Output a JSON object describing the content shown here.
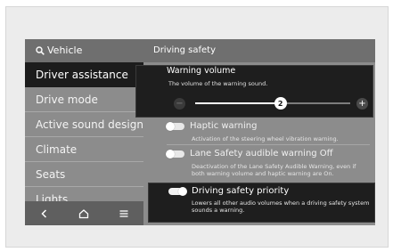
{
  "header": {
    "search_label": "Vehicle",
    "section_title": "Driving safety"
  },
  "sidebar": {
    "items": [
      {
        "label": "Driver assistance",
        "active": true
      },
      {
        "label": "Drive mode",
        "active": false
      },
      {
        "label": "Active sound design",
        "active": false
      },
      {
        "label": "Climate",
        "active": false
      },
      {
        "label": "Seats",
        "active": false
      },
      {
        "label": "Lights",
        "active": false
      }
    ]
  },
  "navbar": {
    "back_icon": "chevron-left-icon",
    "home_icon": "home-icon",
    "menu_icon": "menu-icon"
  },
  "warning_volume": {
    "title": "Warning volume",
    "description": "The volume of the warning sound.",
    "value": "2",
    "level_fraction": 0.55,
    "minus_label": "−",
    "plus_label": "+"
  },
  "options": [
    {
      "title": "Haptic warning",
      "description": "Activation of the steering wheel vibration warning.",
      "enabled": false
    },
    {
      "title": "Lane Safety audible warning Off",
      "description": "Deactivation of the Lane Safety Audible Warning, even if both warning volume and haptic warning are On.",
      "enabled": false
    }
  ],
  "priority": {
    "title": "Driving safety priority",
    "description": "Lowers all other audio volumes when a driving safety system sounds a warning.",
    "enabled": true
  }
}
